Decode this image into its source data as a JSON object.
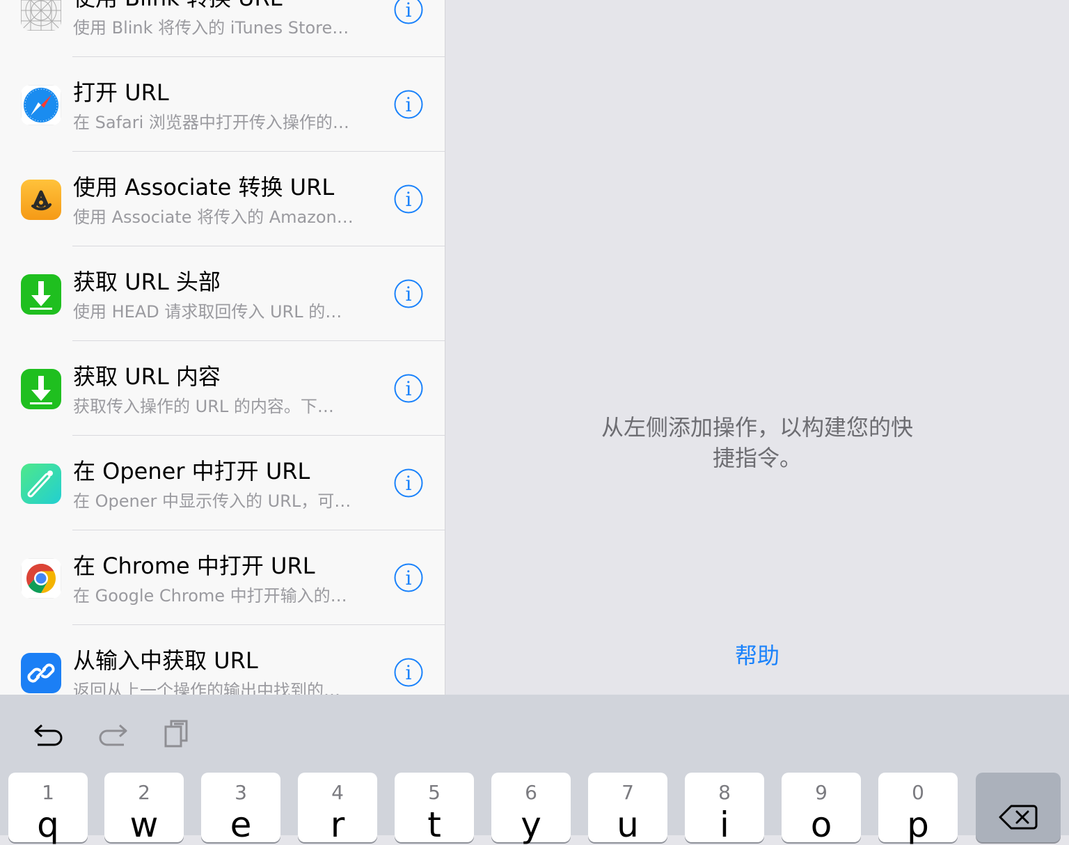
{
  "actions": [
    {
      "title": "使用 Blink 转换 URL",
      "subtitle": "使用 Blink 将传入的 iTunes Store…",
      "icon": "blink-grid-icon"
    },
    {
      "title": "打开 URL",
      "subtitle": "在 Safari 浏览器中打开传入操作的…",
      "icon": "safari-compass-icon"
    },
    {
      "title": "使用 Associate 转换 URL",
      "subtitle": "使用 Associate 将传入的 Amazon…",
      "icon": "associate-icon"
    },
    {
      "title": "获取 URL 头部",
      "subtitle": "使用 HEAD 请求取回传入 URL 的…",
      "icon": "download-arrow-icon"
    },
    {
      "title": "获取 URL 内容",
      "subtitle": "获取传入操作的 URL 的内容。下…",
      "icon": "download-arrow-icon"
    },
    {
      "title": "在 Opener 中打开 URL",
      "subtitle": "在 Opener 中显示传入的 URL，可…",
      "icon": "opener-icon"
    },
    {
      "title": "在 Chrome 中打开 URL",
      "subtitle": "在 Google Chrome 中打开输入的…",
      "icon": "chrome-icon"
    },
    {
      "title": "从输入中获取 URL",
      "subtitle": "返回从上一个操作的输出中找到的…",
      "icon": "link-icon"
    }
  ],
  "info_icon": "info-circle-icon",
  "empty_state": {
    "line1": "从左侧添加操作，以构建您的快",
    "line2": "捷指令。"
  },
  "help_label": "帮助",
  "keyboard": {
    "toolbar": [
      "undo-icon",
      "redo-icon",
      "paste-icon"
    ],
    "keys": [
      {
        "hint": "1",
        "char": "q"
      },
      {
        "hint": "2",
        "char": "w"
      },
      {
        "hint": "3",
        "char": "e"
      },
      {
        "hint": "4",
        "char": "r"
      },
      {
        "hint": "5",
        "char": "t"
      },
      {
        "hint": "6",
        "char": "y"
      },
      {
        "hint": "7",
        "char": "u"
      },
      {
        "hint": "8",
        "char": "i"
      },
      {
        "hint": "9",
        "char": "o"
      },
      {
        "hint": "0",
        "char": "p"
      }
    ],
    "delete_icon": "delete-backspace-icon"
  },
  "colors": {
    "accent": "#1a82fb",
    "list_background": "#f8f8f8",
    "canvas_background": "#e5e5ea",
    "keyboard_background": "#d1d4db"
  }
}
